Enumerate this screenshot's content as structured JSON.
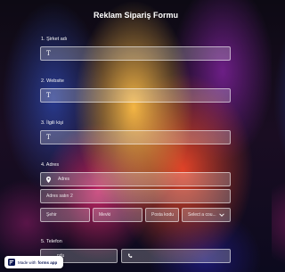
{
  "form": {
    "title": "Reklam Sipariş Formu",
    "fields": {
      "company": {
        "label": "1. Şirket adı",
        "icon": "T"
      },
      "website": {
        "label": "2. Website",
        "icon": "T"
      },
      "contact": {
        "label": "3. İlgili kişi",
        "icon": "T"
      },
      "address": {
        "label": "4. Adres",
        "street_placeholder": "Adres",
        "street2_placeholder": "Adres satırı 2",
        "city_placeholder": "Şehir",
        "state_placeholder": "Mevki",
        "zip_placeholder": "Posta kodu",
        "country_select": "Select a cou..."
      },
      "phone": {
        "label": "5. Telefon",
        "country_code": "ndu"
      }
    }
  },
  "badge": {
    "prefix": "Made with",
    "brand": "forms app"
  },
  "icons": [
    "text-icon",
    "location-pin-icon",
    "chevron-down-icon",
    "phone-icon",
    "forms-app-logo-icon"
  ]
}
